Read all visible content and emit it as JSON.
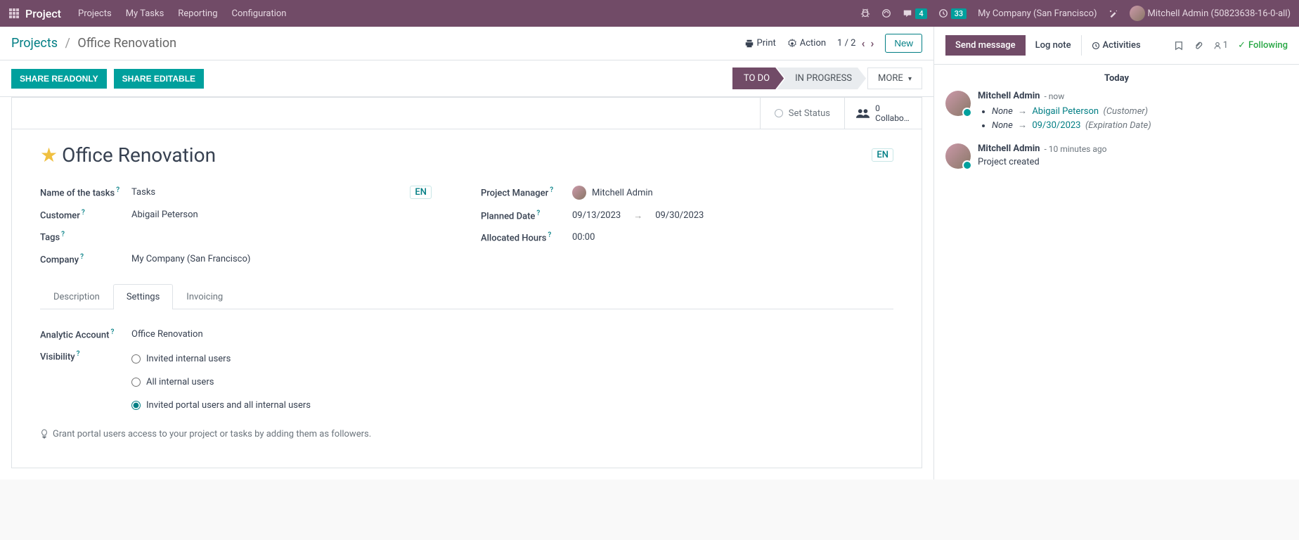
{
  "topnav": {
    "brand": "Project",
    "items": [
      "Projects",
      "My Tasks",
      "Reporting",
      "Configuration"
    ],
    "chat_badge": "4",
    "activity_badge": "33",
    "company": "My Company (San Francisco)",
    "user": "Mitchell Admin (50823638-16-0-all)"
  },
  "breadcrumb": {
    "root": "Projects",
    "current": "Office Renovation",
    "print": "Print",
    "action": "Action",
    "pager": "1 / 2",
    "new": "New"
  },
  "statusbar": {
    "share_readonly": "SHARE READONLY",
    "share_editable": "SHARE EDITABLE",
    "stages": [
      "TO DO",
      "IN PROGRESS",
      "MORE"
    ]
  },
  "sheet": {
    "set_status": "Set Status",
    "collab_count": "0",
    "collab_label": "Collabor…",
    "title": "Office Renovation",
    "lang": "EN",
    "fields": {
      "name_tasks_label": "Name of the tasks",
      "name_tasks_value": "Tasks",
      "customer_label": "Customer",
      "customer_value": "Abigail Peterson",
      "tags_label": "Tags",
      "company_label": "Company",
      "company_value": "My Company (San Francisco)",
      "pm_label": "Project Manager",
      "pm_value": "Mitchell Admin",
      "planned_label": "Planned Date",
      "planned_from": "09/13/2023",
      "planned_to": "09/30/2023",
      "hours_label": "Allocated Hours",
      "hours_value": "00:00"
    },
    "tabs": [
      "Description",
      "Settings",
      "Invoicing"
    ],
    "settings": {
      "analytic_label": "Analytic Account",
      "analytic_value": "Office Renovation",
      "visibility_label": "Visibility",
      "vis_opt1": "Invited internal users",
      "vis_opt2": "All internal users",
      "vis_opt3": "Invited portal users and all internal users",
      "hint": "Grant portal users access to your project or tasks by adding them as followers."
    }
  },
  "chatter": {
    "send": "Send message",
    "log": "Log note",
    "activities": "Activities",
    "follower_count": "1",
    "following": "Following",
    "today": "Today",
    "msg1": {
      "author": "Mitchell Admin",
      "time": "- now",
      "c1_from": "None",
      "c1_to": "Abigail Peterson",
      "c1_field": "(Customer)",
      "c2_from": "None",
      "c2_to": "09/30/2023",
      "c2_field": "(Expiration Date)"
    },
    "msg2": {
      "author": "Mitchell Admin",
      "time": "- 10 minutes ago",
      "body": "Project created"
    }
  }
}
